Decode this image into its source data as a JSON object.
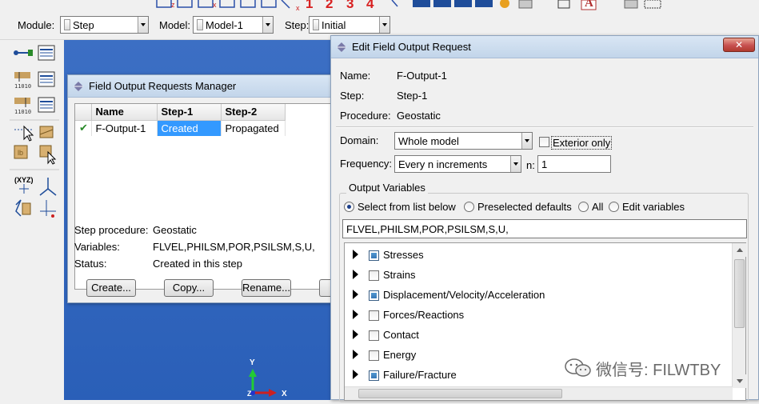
{
  "context_bar": {
    "module_label": "Module:",
    "module_value": "Step",
    "model_label": "Model:",
    "model_value": "Model-1",
    "step_label": "Step:",
    "step_value": "Initial"
  },
  "top_toolbar": {
    "numbers": [
      "1",
      "2",
      "3",
      "4"
    ]
  },
  "toolbox": {
    "xyz_label": "(XYZ)"
  },
  "viewport": {
    "axis_y": "Y",
    "axis_x": "X",
    "axis_z": "Z"
  },
  "manager": {
    "title": "Field Output Requests Manager",
    "columns": [
      "Name",
      "Step-1",
      "Step-2"
    ],
    "rows": [
      {
        "check": "✔",
        "name": "F-Output-1",
        "step1": "Created",
        "step2": "Propagated"
      }
    ],
    "step_procedure_label": "Step procedure:",
    "step_procedure_value": "Geostatic",
    "variables_label": "Variables:",
    "variables_value": "FLVEL,PHILSM,POR,PSILSM,S,U,",
    "status_label": "Status:",
    "status_value": "Created in this step",
    "buttons": {
      "create": "Create...",
      "copy": "Copy...",
      "rename": "Rename..."
    }
  },
  "edit": {
    "title": "Edit Field Output Request",
    "close_label": "✕",
    "name_label": "Name:",
    "name_value": "F-Output-1",
    "step_label": "Step:",
    "step_value": "Step-1",
    "procedure_label": "Procedure:",
    "procedure_value": "Geostatic",
    "domain_label": "Domain:",
    "domain_value": "Whole model",
    "exterior_only_label": "Exterior only",
    "frequency_label": "Frequency:",
    "frequency_value": "Every n increments",
    "n_label": "n:",
    "n_value": "1",
    "output_variables_title": "Output Variables",
    "radio_options": [
      "Select from list below",
      "Preselected defaults",
      "All",
      "Edit variables"
    ],
    "selected_radio": 0,
    "variables_text": "FLVEL,PHILSM,POR,PSILSM,S,U,",
    "tree_items": [
      {
        "label": "Stresses",
        "checked": true
      },
      {
        "label": "Strains",
        "checked": false
      },
      {
        "label": "Displacement/Velocity/Acceleration",
        "checked": true
      },
      {
        "label": "Forces/Reactions",
        "checked": false
      },
      {
        "label": "Contact",
        "checked": false
      },
      {
        "label": "Energy",
        "checked": false
      },
      {
        "label": "Failure/Fracture",
        "checked": true
      }
    ]
  },
  "watermark": {
    "text": "微信号: FILWTBY"
  },
  "colors": {
    "viewport_blue": "#2f63bb",
    "selection_blue": "#3399ff",
    "close_red": "#c75050"
  }
}
